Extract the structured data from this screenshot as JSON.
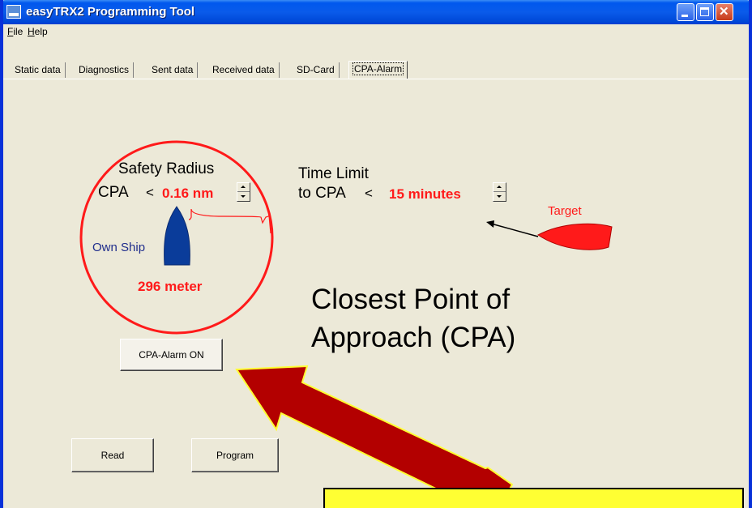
{
  "window": {
    "title": "easyTRX2 Programming Tool"
  },
  "menu": {
    "file": "File",
    "help": "Help"
  },
  "tabs": [
    "Static data",
    "Diagnostics",
    "Sent data",
    "Received data",
    "SD-Card",
    "CPA-Alarm"
  ],
  "active_tab": "CPA-Alarm",
  "safety": {
    "title": "Safety Radius",
    "cpa_label": "CPA",
    "less_than": "<",
    "cpa_value": "0.16 nm",
    "meter_value": "296 meter",
    "own_ship_label": "Own Ship"
  },
  "time_limit": {
    "line1": "Time Limit",
    "line2": "to CPA",
    "less_than": "<",
    "value": "15 minutes"
  },
  "target_label": "Target",
  "heading": {
    "line1": "Closest Point of",
    "line2": "Approach (CPA)"
  },
  "buttons": {
    "alarm": "CPA-Alarm ON",
    "read": "Read",
    "program": "Program"
  },
  "colors": {
    "accent_red": "#ff1a1a",
    "own_ship": "#0a3c9a",
    "label_blue": "#1f2d8c",
    "arrow": "#b30000",
    "callout": "#ffff33"
  }
}
